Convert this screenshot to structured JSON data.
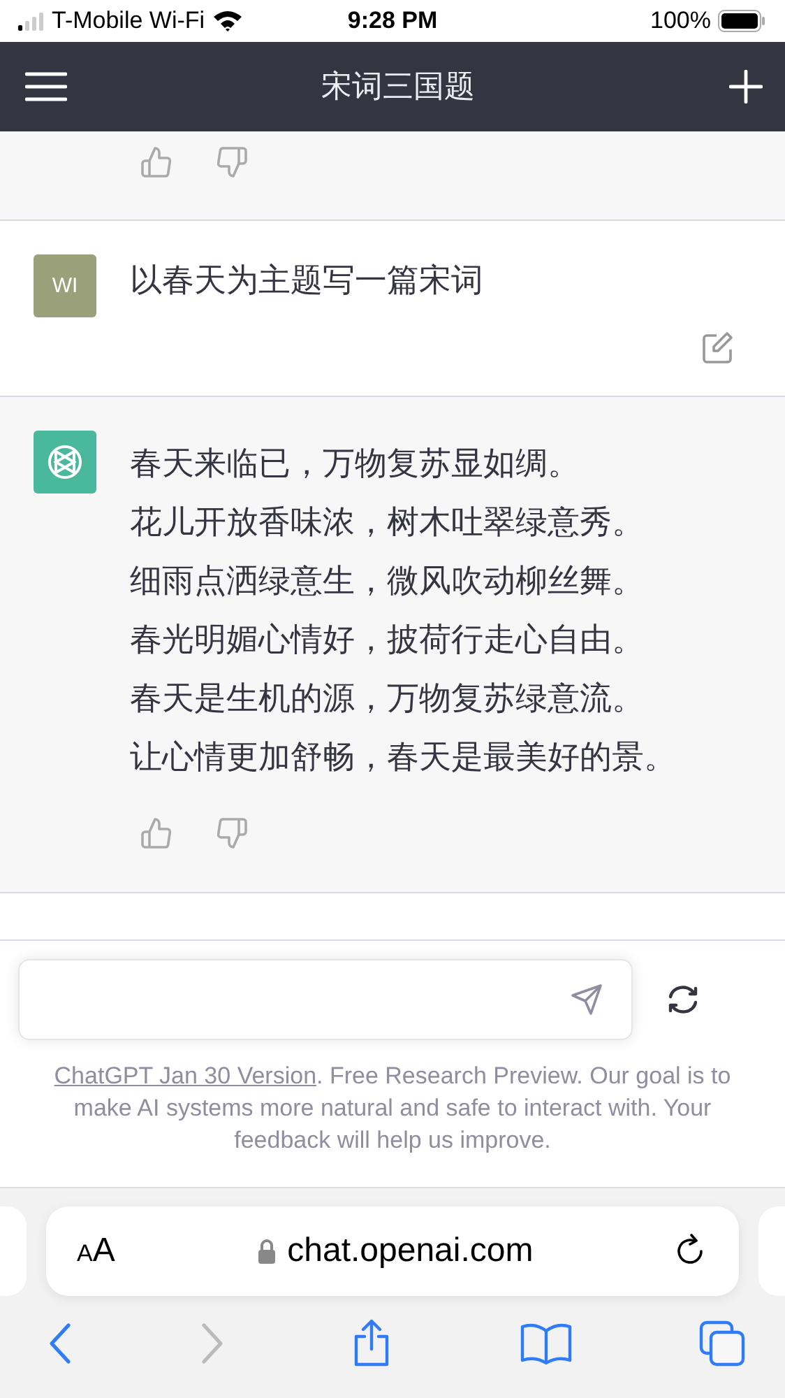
{
  "status_bar": {
    "carrier": "T-Mobile Wi-Fi",
    "time": "9:28 PM",
    "battery": "100%"
  },
  "header": {
    "title": "宋词三国题"
  },
  "messages": [
    {
      "kind": "stub"
    },
    {
      "kind": "user",
      "avatar": "WI",
      "lines": [
        "以春天为主题写一篇宋词"
      ]
    },
    {
      "kind": "assistant",
      "lines": [
        "春天来临已，万物复苏显如绸。",
        "花儿开放香味浓，树木吐翠绿意秀。",
        "细雨点洒绿意生，微风吹动柳丝舞。",
        "春光明媚心情好，披荷行走心自由。",
        "春天是生机的源，万物复苏绿意流。",
        "让心情更加舒畅，春天是最美好的景。"
      ]
    }
  ],
  "footer": {
    "link": "ChatGPT Jan 30 Version",
    "text": ". Free Research Preview. Our goal is to make AI systems more natural and safe to interact with. Your feedback will help us improve."
  },
  "browser": {
    "aa_small": "A",
    "aa_large": "A",
    "url": "chat.openai.com",
    "back_disabled": false,
    "forward_disabled": true
  }
}
